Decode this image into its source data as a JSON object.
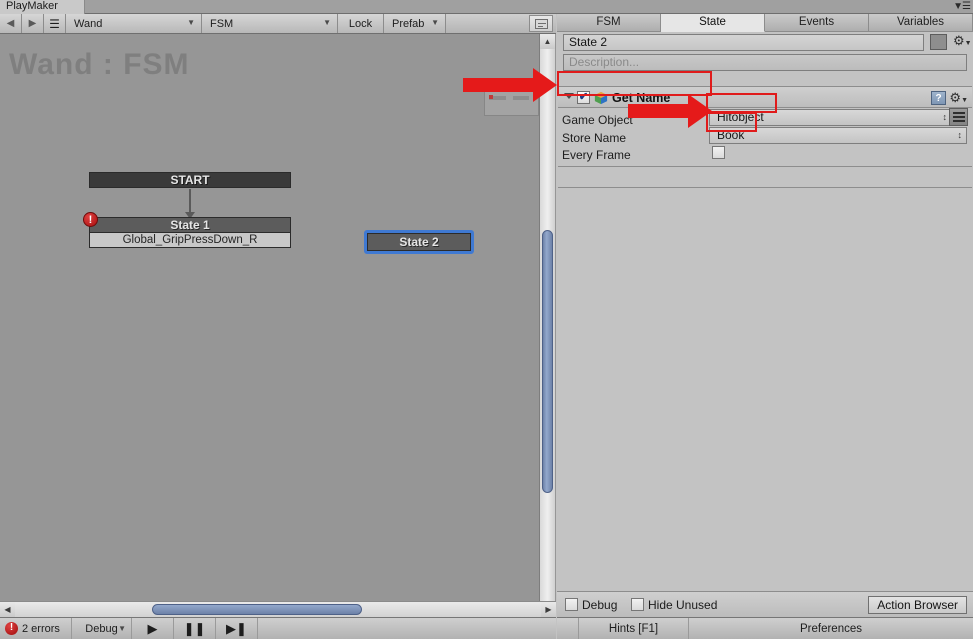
{
  "window": {
    "tab_label": "PlayMaker",
    "menu_icon": "hamburger-menu-icon"
  },
  "toolbar": {
    "back_icon": "back-arrow-icon",
    "forward_icon": "forward-arrow-icon",
    "menu_icon": "hamburger-menu-icon",
    "object_selector": "Wand",
    "fsm_selector": "FSM",
    "lock_label": "Lock",
    "prefab_label": "Prefab",
    "minimap_toggle_icon": "minimap-icon"
  },
  "canvas": {
    "title": "Wand : FSM",
    "nodes": [
      {
        "name": "START",
        "type": "start"
      },
      {
        "name": "State 1",
        "transition": "Global_GripPressDown_R",
        "has_error": true,
        "error_glyph": "!"
      },
      {
        "name": "State 2",
        "type": "selected"
      }
    ],
    "minimap": {
      "label": "minimap-overlay"
    }
  },
  "left_status": {
    "errors_text": "2 errors",
    "error_glyph": "!",
    "debug_label": "Debug",
    "play_icon": "play-icon",
    "pause_icon": "pause-icon",
    "step_icon": "step-forward-icon"
  },
  "inspector": {
    "tabs": [
      {
        "label": "FSM",
        "active": false
      },
      {
        "label": "State",
        "active": true
      },
      {
        "label": "Events",
        "active": false
      },
      {
        "label": "Variables",
        "active": false
      }
    ],
    "state_name": "State 2",
    "description_placeholder": "Description...",
    "color_swatch_icon": "color-swatch-icon",
    "settings_icon": "gear-icon",
    "action": {
      "fold_icon": "triangle-down-icon",
      "enabled_check": "✔",
      "type_icon": "unity-cube-icon",
      "name": "Get Name",
      "help_icon": "help-icon",
      "settings_icon": "gear-icon",
      "fields": [
        {
          "label": "Game Object",
          "value": "Hitobject",
          "kind": "dropdown",
          "has_picker": true
        },
        {
          "label": "Store Name",
          "value": "Book",
          "kind": "dropdown",
          "has_picker": false
        },
        {
          "label": "Every Frame",
          "value": "",
          "kind": "checkbox",
          "checked": false
        }
      ]
    },
    "footer": {
      "debug_label": "Debug",
      "hide_unused_label": "Hide Unused",
      "action_browser_label": "Action Browser"
    },
    "status": {
      "hints_label": "Hints [F1]",
      "preferences_label": "Preferences"
    }
  },
  "annotations": {
    "accent_color": "#e51a1a",
    "boxes": [
      "get-name-action",
      "game-object-value",
      "store-name-value"
    ],
    "arrows": [
      "arrow-to-get-name",
      "arrow-to-game-object"
    ]
  }
}
